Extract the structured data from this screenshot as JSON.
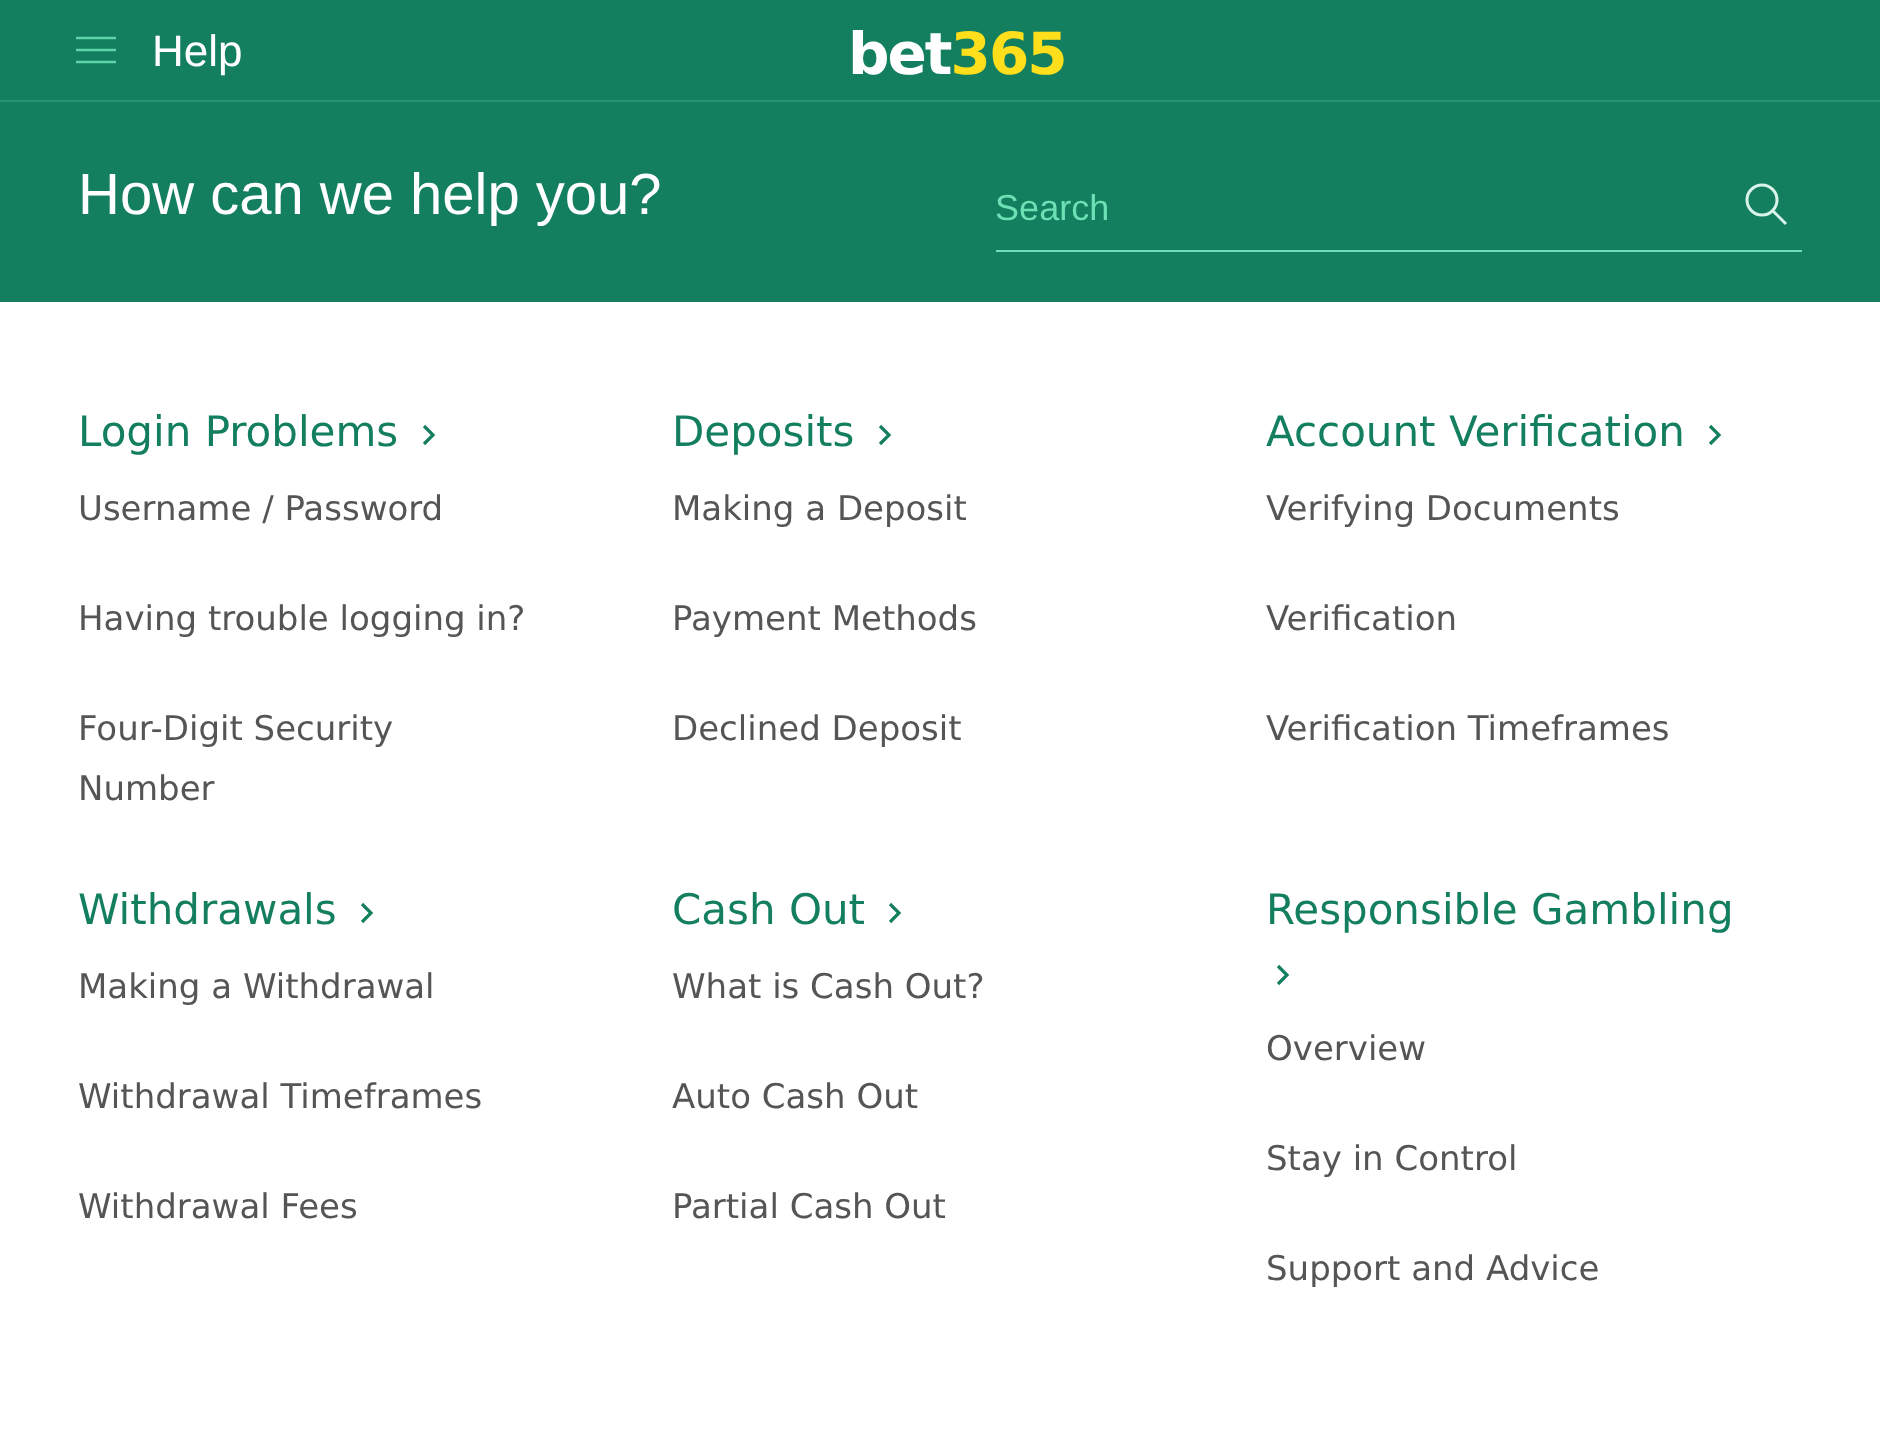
{
  "header": {
    "menu_label": "Help",
    "logo": {
      "part_1": "bet",
      "part_2": "365"
    }
  },
  "hero": {
    "title": "How can we help you?",
    "search": {
      "placeholder": "Search"
    }
  },
  "sections": [
    {
      "title": "Login Problems",
      "links": [
        "Username / Password",
        "Having trouble logging in?",
        "Four-Digit Security Number"
      ]
    },
    {
      "title": "Deposits",
      "links": [
        "Making a Deposit",
        "Payment Methods",
        "Declined Deposit"
      ]
    },
    {
      "title": "Account Verification",
      "links": [
        "Verifying Documents",
        "Verification",
        "Verification Timeframes"
      ]
    },
    {
      "title": "Withdrawals",
      "links": [
        "Making a Withdrawal",
        "Withdrawal Timeframes",
        "Withdrawal Fees"
      ]
    },
    {
      "title": "Cash Out",
      "links": [
        "What is Cash Out?",
        "Auto Cash Out",
        "Partial Cash Out"
      ]
    },
    {
      "title": "Responsible Gambling",
      "links": [
        "Overview",
        "Stay in Control",
        "Support and Advice"
      ]
    }
  ]
}
